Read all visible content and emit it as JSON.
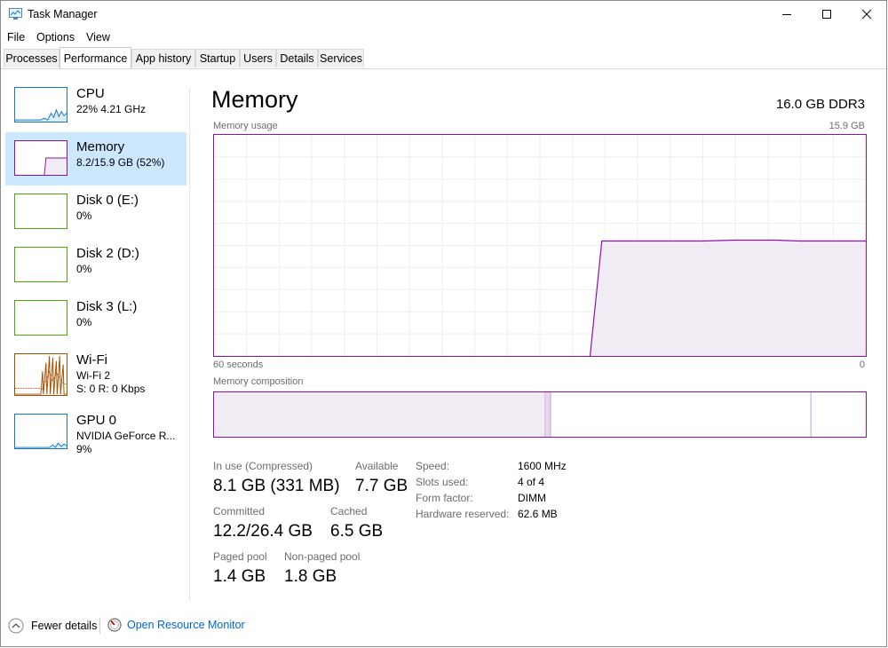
{
  "window": {
    "title": "Task Manager"
  },
  "menu": [
    "File",
    "Options",
    "View"
  ],
  "tabs": [
    "Processes",
    "Performance",
    "App history",
    "Startup",
    "Users",
    "Details",
    "Services"
  ],
  "active_tab": "Performance",
  "sidebar": [
    {
      "name": "CPU",
      "line1": "22% 4.21 GHz",
      "line2": "",
      "color": "#1779ba"
    },
    {
      "name": "Memory",
      "line1": "8.2/15.9 GB (52%)",
      "line2": "",
      "color": "#8b12ae"
    },
    {
      "name": "Disk 0 (E:)",
      "line1": "0%",
      "line2": "",
      "color": "#4da60c"
    },
    {
      "name": "Disk 2 (D:)",
      "line1": "0%",
      "line2": "",
      "color": "#4da60c"
    },
    {
      "name": "Disk 3 (L:)",
      "line1": "0%",
      "line2": "",
      "color": "#4da60c"
    },
    {
      "name": "Wi-Fi",
      "line1": "Wi-Fi 2",
      "line2": "S: 0 R: 0 Kbps",
      "color": "#a74f01"
    },
    {
      "name": "GPU 0",
      "line1": "NVIDIA GeForce R...",
      "line2": "9%",
      "color": "#1779ba"
    }
  ],
  "main": {
    "title": "Memory",
    "capacity": "16.0 GB DDR3",
    "usage_label": "Memory usage",
    "usage_max": "15.9 GB",
    "time_left": "60 seconds",
    "time_right": "0",
    "composition_label": "Memory composition",
    "usage_level_fraction": 0.52
  },
  "stats": {
    "in_use_label": "In use (Compressed)",
    "in_use_value": "8.1 GB (331 MB)",
    "available_label": "Available",
    "available_value": "7.7 GB",
    "committed_label": "Committed",
    "committed_value": "12.2/26.4 GB",
    "cached_label": "Cached",
    "cached_value": "6.5 GB",
    "paged_label": "Paged pool",
    "paged_value": "1.4 GB",
    "nonpaged_label": "Non-paged pool",
    "nonpaged_value": "1.8 GB"
  },
  "specs": [
    {
      "label": "Speed:",
      "value": "1600 MHz"
    },
    {
      "label": "Slots used:",
      "value": "4 of 4"
    },
    {
      "label": "Form factor:",
      "value": "DIMM"
    },
    {
      "label": "Hardware reserved:",
      "value": "62.6 MB"
    }
  ],
  "footer": {
    "fewer_details": "Fewer details",
    "open_monitor": "Open Resource Monitor"
  },
  "colors": {
    "accent": "#8b12ae",
    "link": "#0066cc",
    "selected": "#cce8ff"
  }
}
